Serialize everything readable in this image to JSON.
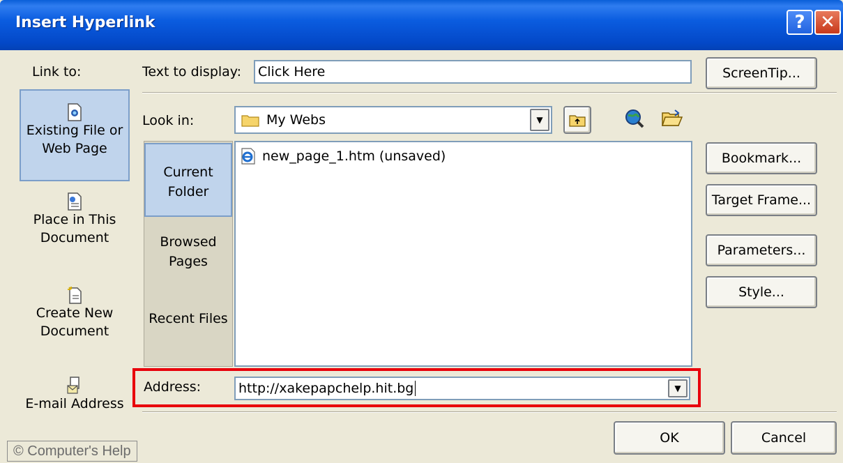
{
  "window": {
    "title": "Insert Hyperlink",
    "help_glyph": "?",
    "close_glyph": "✕"
  },
  "link_to": {
    "label": "Link to:",
    "items": [
      {
        "label": "Existing File or Web Page",
        "icon": "web-page-icon",
        "selected": true
      },
      {
        "label": "Place in This Document",
        "icon": "document-place-icon",
        "selected": false
      },
      {
        "label": "Create New Document",
        "icon": "new-document-icon",
        "selected": false
      },
      {
        "label": "E-mail Address",
        "icon": "email-icon",
        "selected": false
      }
    ]
  },
  "text_to_display": {
    "label": "Text to display:",
    "value": "Click Here"
  },
  "look_in": {
    "label": "Look in:",
    "value": "My Webs",
    "icon": "folder-icon"
  },
  "nav": [
    {
      "label": "Current Folder",
      "selected": true
    },
    {
      "label": "Browsed Pages",
      "selected": false
    },
    {
      "label": "Recent Files",
      "selected": false
    }
  ],
  "files": [
    {
      "name": "new_page_1.htm (unsaved)",
      "icon": "ie-page-icon"
    }
  ],
  "address": {
    "label": "Address:",
    "value": "http://xakepapchelp.hit.bg"
  },
  "buttons": {
    "screentip": "ScreenTip...",
    "bookmark": "Bookmark...",
    "target_frame": "Target Frame...",
    "parameters": "Parameters...",
    "style": "Style...",
    "ok": "OK",
    "cancel": "Cancel"
  },
  "watermark": "© Computer's Help",
  "colors": {
    "titlebar": "#0348c8",
    "highlight": "#e8000b",
    "selected_bg": "#c0d4ec",
    "dialog_bg": "#ece9d8"
  }
}
